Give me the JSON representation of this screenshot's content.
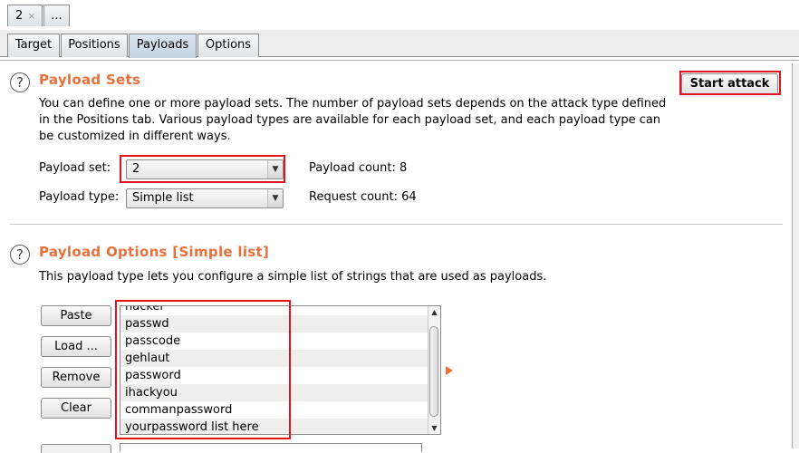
{
  "attack_tabs": [
    {
      "label": "2",
      "close": "×"
    },
    {
      "label": "..."
    }
  ],
  "tabs": [
    "Target",
    "Positions",
    "Payloads",
    "Options"
  ],
  "active_tab": "Payloads",
  "payload_sets": {
    "title": "Payload Sets",
    "description": "You can define one or more payload sets. The number of payload sets depends on the attack type defined in the Positions tab. Various payload types are available for each payload set, and each payload type can be customized in different ways.",
    "description_lines": [
      "You can define one or more payload sets. The number of payload sets depends on the attack type defined",
      "in the Positions tab. Various payload types are available for each payload set, and each payload type can",
      "be customized in different ways."
    ],
    "payload_set_label": "Payload set:",
    "payload_set_value": "2",
    "payload_type_label": "Payload type:",
    "payload_type_value": "Simple list",
    "payload_count_label": "Payload count:",
    "payload_count_value": "8",
    "request_count_label": "Request count:",
    "request_count_value": "64",
    "start_attack": "Start attack"
  },
  "payload_options": {
    "title": "Payload Options [Simple list]",
    "description": "This payload type lets you configure a simple list of strings that are used as payloads.",
    "buttons": {
      "paste": "Paste",
      "load": "Load ...",
      "remove": "Remove",
      "clear": "Clear"
    },
    "list_items": [
      "hacker",
      "passwd",
      "passcode",
      "gehlaut",
      "password",
      "ihackyou",
      "commanpassword",
      "yourpassword list here"
    ]
  },
  "colors": {
    "accent_title": "#e8703a",
    "highlight": "#e0141e"
  },
  "icons": {
    "help": "question-circle-icon",
    "scroll_up": "scroll-up-arrow-icon",
    "scroll_down": "scroll-down-arrow-icon",
    "dropdown": "chevron-down-icon",
    "expand": "orange-triangle-right-icon"
  }
}
